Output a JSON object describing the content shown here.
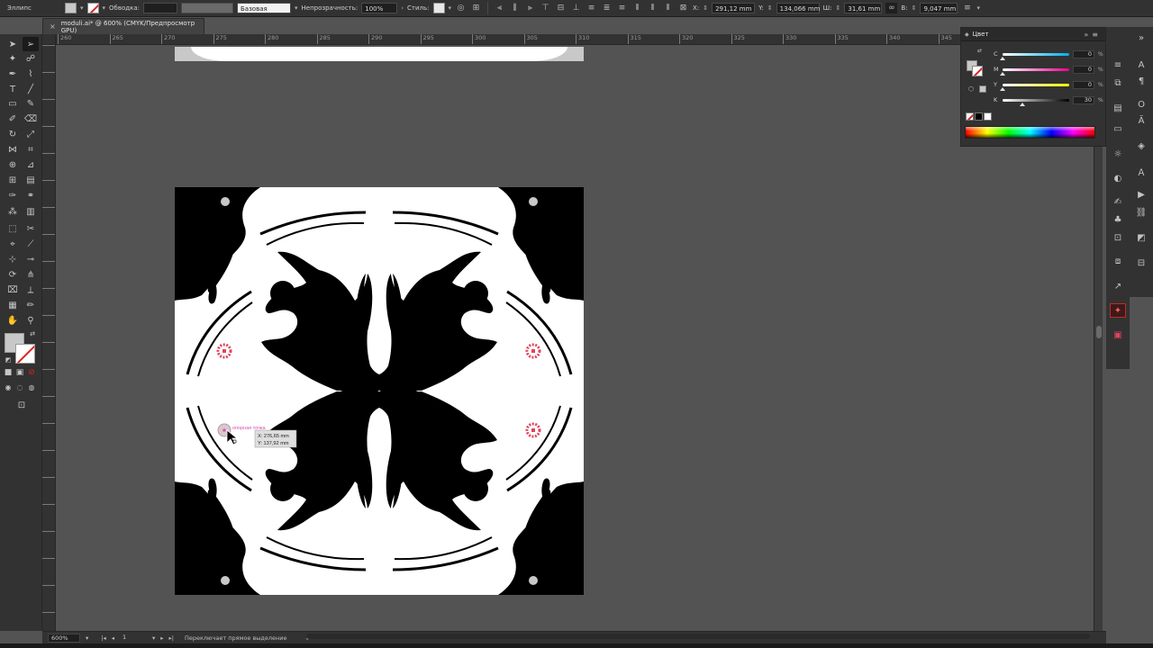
{
  "control_bar": {
    "object_type": "Эллипс",
    "stroke_label": "Обводка:",
    "stroke_profile": "Базовая",
    "opacity_label": "Непрозрачность:",
    "opacity_value": "100%",
    "style_label": "Стиль:",
    "x_label": "X:",
    "x_value": "291,12 mm",
    "y_label": "Y:",
    "y_value": "134,066 mm",
    "w_label": "Ш:",
    "w_value": "31,61 mm",
    "h_label": "В:",
    "h_value": "9,047 mm"
  },
  "document_tab": {
    "close_glyph": "×",
    "title": "moduli.ai* @ 600% (CMYK/Предпросмотр GPU)"
  },
  "ruler": {
    "h_ticks": [
      "260",
      "265",
      "270",
      "275",
      "280",
      "285",
      "290",
      "295",
      "300",
      "305",
      "310",
      "315",
      "320",
      "325",
      "330",
      "335",
      "340",
      "345"
    ]
  },
  "smart_guide": {
    "anchor_label": "опорная точка",
    "x_readout": "X: 276,65 mm",
    "y_readout": "Y: 137,92 mm"
  },
  "color_panel": {
    "title": "Цвет",
    "channels": [
      {
        "label": "C",
        "value": "0",
        "unit": "%",
        "fraction": 0.0,
        "from": "#ffffff",
        "to": "#00aeef"
      },
      {
        "label": "M",
        "value": "0",
        "unit": "%",
        "fraction": 0.0,
        "from": "#ffffff",
        "to": "#ec008c"
      },
      {
        "label": "Y",
        "value": "0",
        "unit": "%",
        "fraction": 0.0,
        "from": "#ffffff",
        "to": "#fff200"
      },
      {
        "label": "K",
        "value": "30",
        "unit": "%",
        "fraction": 0.3,
        "from": "#ffffff",
        "to": "#000000"
      }
    ]
  },
  "status_bar": {
    "zoom": "600%",
    "page": "1",
    "tool_hint": "Переключает прямое выделение"
  },
  "colors": {
    "ui_dark": "#323232",
    "canvas": "#535353",
    "selection_red": "#e0445c",
    "anchor_pink": "#d64fb4",
    "artwork_black": "#000000",
    "artwork_white": "#ffffff",
    "bleed_gray": "#c8c8c8"
  }
}
